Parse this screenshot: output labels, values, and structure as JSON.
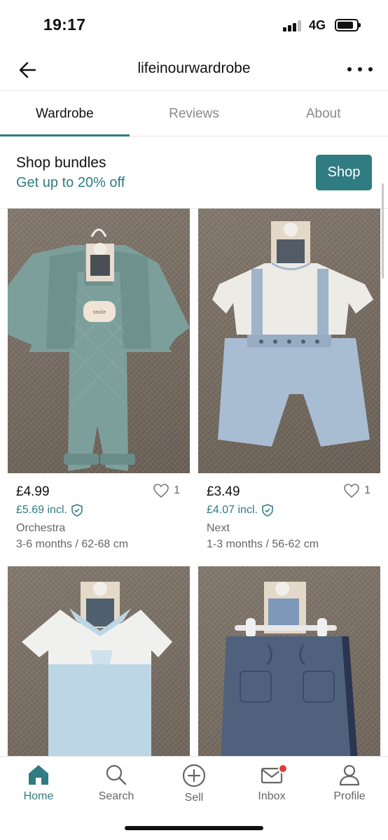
{
  "status": {
    "time": "19:17",
    "network": "4G"
  },
  "header": {
    "title": "lifeinourwardrobe",
    "back_icon": "arrow-left-icon",
    "more_icon": "more-horizontal-icon"
  },
  "tabs": [
    {
      "label": "Wardrobe",
      "active": true
    },
    {
      "label": "Reviews",
      "active": false
    },
    {
      "label": "About",
      "active": false
    }
  ],
  "bundle": {
    "title": "Shop bundles",
    "subtitle": "Get up to 20% off",
    "button": "Shop"
  },
  "items": [
    {
      "price": "£4.99",
      "price_incl": "£5.69 incl.",
      "favorites": "1",
      "brand": "Orchestra",
      "size": "3-6 months / 62-68 cm",
      "photo": "sage green quilted romper with jacket on hanger"
    },
    {
      "price": "£3.49",
      "price_incl": "£4.07 incl.",
      "favorites": "1",
      "brand": "Next",
      "size": "1-3 months / 56-62 cm",
      "photo": "white shirt with light blue dungaree shorts"
    },
    {
      "photo": "white and light blue collared romper"
    },
    {
      "photo": "navy jogging trousers on hanger"
    }
  ],
  "nav": [
    {
      "label": "Home",
      "icon": "home-icon",
      "active": true
    },
    {
      "label": "Search",
      "icon": "search-icon",
      "active": false
    },
    {
      "label": "Sell",
      "icon": "plus-circle-icon",
      "active": false
    },
    {
      "label": "Inbox",
      "icon": "mail-icon",
      "active": false,
      "badge": true
    },
    {
      "label": "Profile",
      "icon": "user-icon",
      "active": false
    }
  ],
  "colors": {
    "accent": "#2f7c82",
    "badge": "#e03c3c"
  }
}
